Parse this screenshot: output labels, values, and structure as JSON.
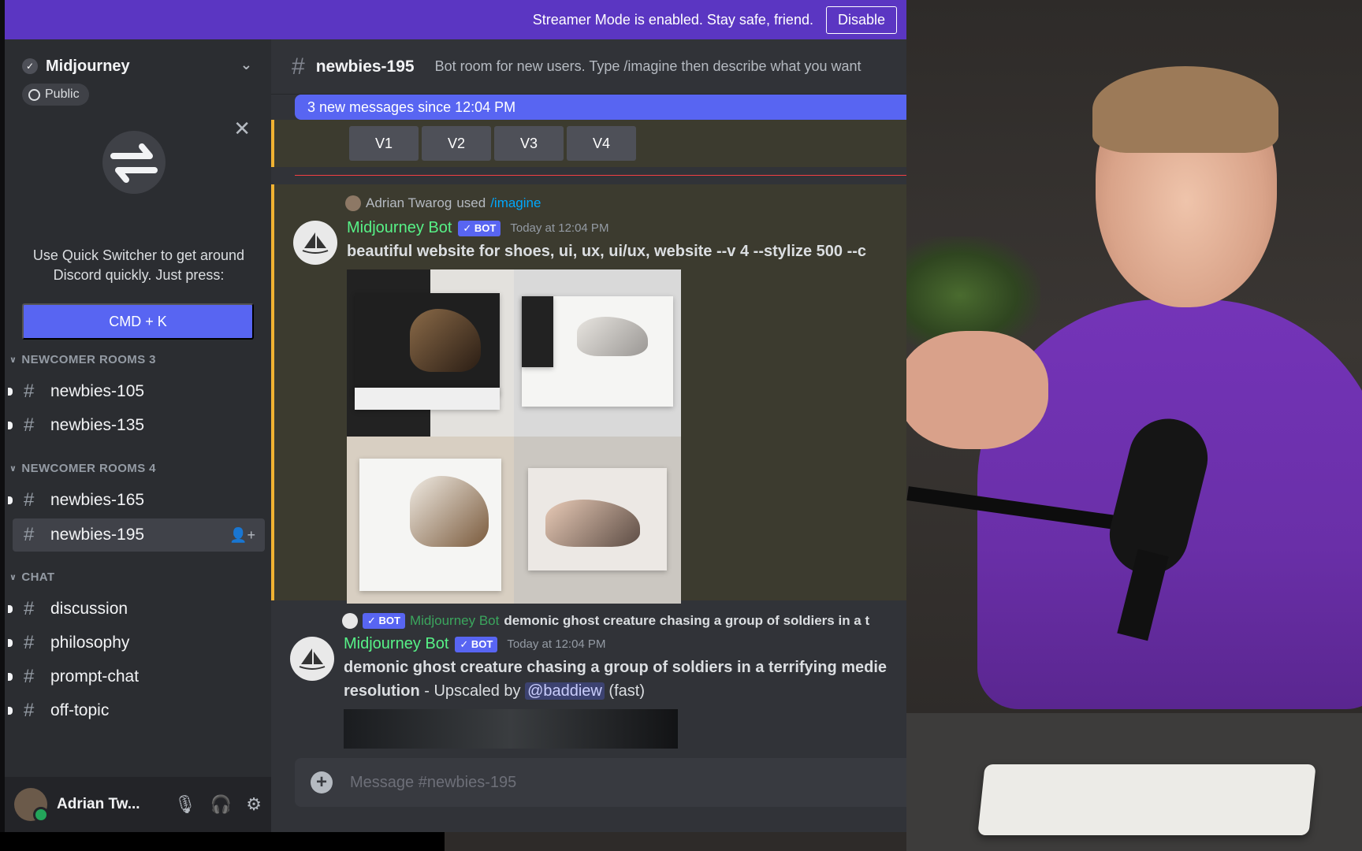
{
  "streamer": {
    "message": "Streamer Mode is enabled. Stay safe, friend.",
    "disable_label": "Disable"
  },
  "server": {
    "name": "Midjourney",
    "visibility": "Public"
  },
  "quick_switcher": {
    "text": "Use Quick Switcher to get around Discord quickly. Just press:",
    "shortcut": "CMD + K"
  },
  "categories": [
    {
      "name": "NEWCOMER ROOMS 3",
      "channels": [
        "newbies-105",
        "newbies-135"
      ]
    },
    {
      "name": "NEWCOMER ROOMS 4",
      "channels": [
        "newbies-165",
        "newbies-195"
      ]
    },
    {
      "name": "CHAT",
      "channels": [
        "discussion",
        "philosophy",
        "prompt-chat",
        "off-topic"
      ]
    }
  ],
  "user": {
    "name": "Adrian Tw..."
  },
  "channel": {
    "name": "newbies-195",
    "topic": "Bot room for new users. Type /imagine then describe what you want"
  },
  "new_messages_banner": "3 new messages since 12:04 PM",
  "variation_buttons": [
    "V1",
    "V2",
    "V3",
    "V4"
  ],
  "message1": {
    "reply_user": "Adrian Twarog",
    "reply_used": "used",
    "reply_command": "/imagine",
    "author": "Midjourney Bot",
    "badge": "✓ BOT",
    "time": "Today at 12:04 PM",
    "prompt": "beautiful website for shoes, ui, ux, ui/ux, website --v 4 --stylize 500 --c"
  },
  "message2": {
    "reply_badge": "✓ BOT",
    "reply_author": "Midjourney Bot",
    "reply_text": "demonic ghost creature chasing a group of soldiers in a t",
    "author": "Midjourney Bot",
    "badge": "✓ BOT",
    "time": "Today at 12:04 PM",
    "prompt_line1": "demonic ghost creature chasing a group of soldiers in a terrifying medie",
    "prompt_line2_bold": "resolution",
    "prompt_line2_mid": " - Upscaled by ",
    "mention": "@baddiew",
    "speed": " (fast)"
  },
  "composer": {
    "placeholder": "Message #newbies-195"
  }
}
